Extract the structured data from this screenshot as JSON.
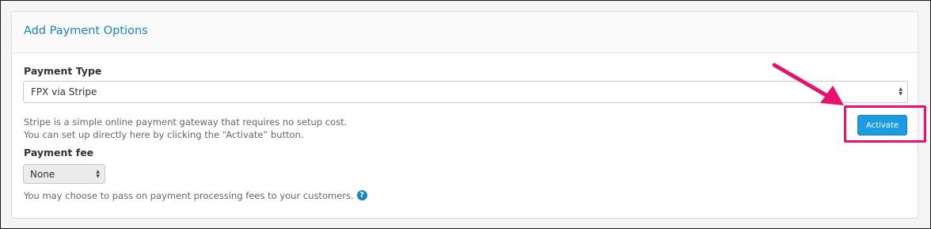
{
  "panel": {
    "title": "Add Payment Options"
  },
  "payment_type": {
    "label": "Payment Type",
    "selected": "FPX via Stripe"
  },
  "description": {
    "line1": "Stripe is a simple online payment gateway that requires no setup cost.",
    "line2": "You can set up directly here by clicking the “Activate” button."
  },
  "activate_button": {
    "label": "Activate"
  },
  "payment_fee": {
    "label": "Payment fee",
    "selected": "None",
    "help_text": "You may choose to pass on payment processing fees to your customers."
  },
  "icons": {
    "help": "question-circle-icon",
    "select_arrows": "up-down-arrows-icon",
    "annotation": "pointer-arrow-icon"
  },
  "colors": {
    "accent": "#1a84c6",
    "button": "#1d9be0",
    "annotation": "#e8126e"
  }
}
